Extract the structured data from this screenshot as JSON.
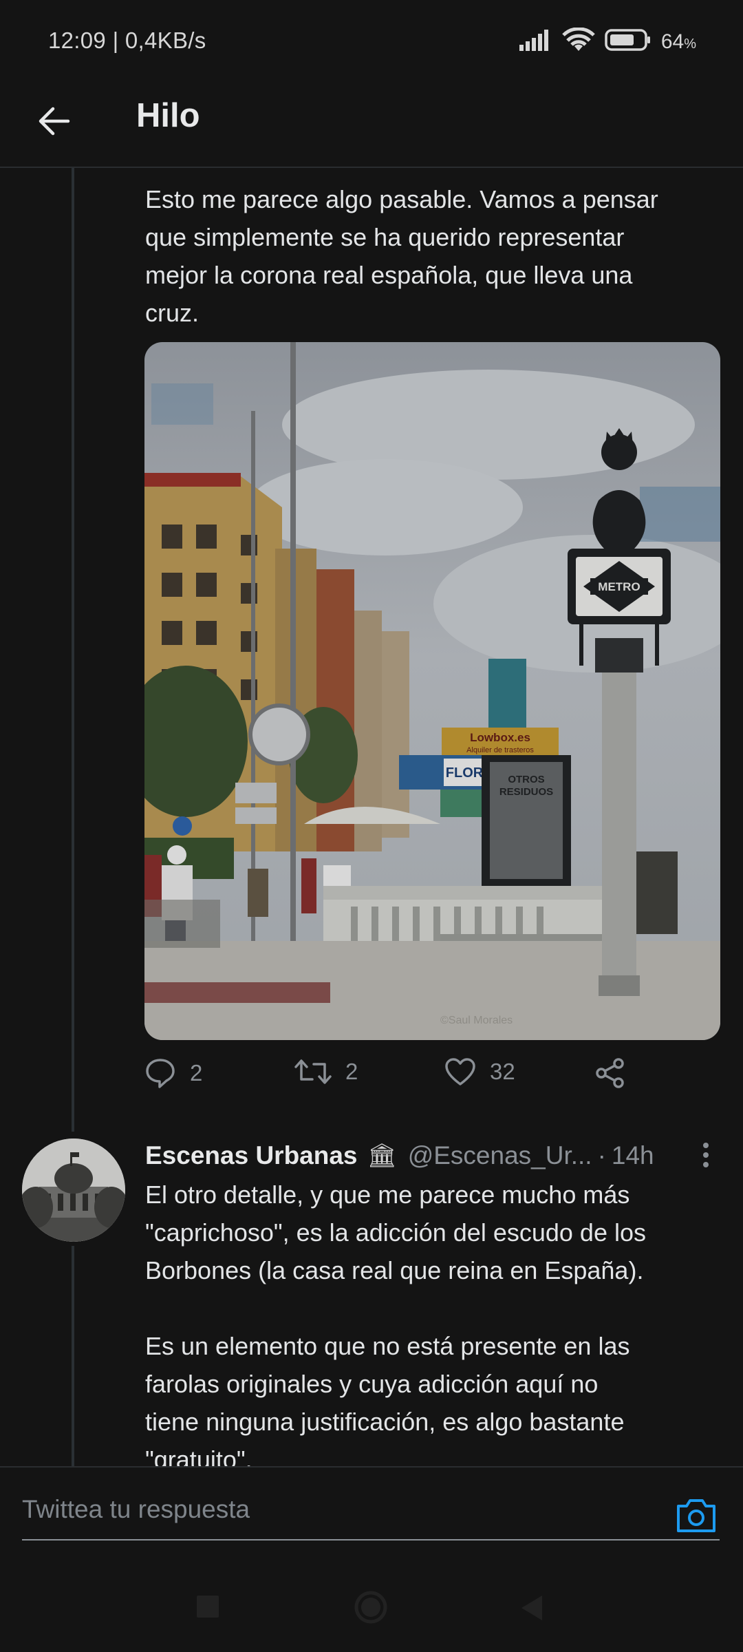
{
  "status": {
    "time": "12:09",
    "speed": "0,4KB/s",
    "battery_pct": "64",
    "battery_unit": "%",
    "icons": [
      "signal-icon",
      "wifi-icon",
      "battery-icon"
    ]
  },
  "header": {
    "title": "Hilo",
    "back_icon": "arrow-left-icon"
  },
  "tweet1": {
    "text": "Esto me parece algo pasable. Vamos a pensar\nque simplemente se ha querido representar\nmejor la corona real española, que lleva una\ncruz.",
    "image": {
      "sign_text": "METRO",
      "shop_sign_1": "Lowbox.es",
      "shop_sign_2": "Alquiler de trasteros",
      "shop_sign_3": "FLOR",
      "kiosk_text": "OTROS\nRESIDUOS",
      "watermark": "©Saul Morales"
    },
    "actions": {
      "replies": "2",
      "retweets": "2",
      "likes": "32"
    }
  },
  "tweet2": {
    "name": "Escenas Urbanas",
    "name_badge": "🏛",
    "handle": "@Escenas_Ur...",
    "time": "14h",
    "text": "El otro detalle, y que me parece mucho más\n\"caprichoso\", es la adicción del escudo de los\nBorbones (la casa real que reina en España).",
    "text2": "Es un elemento que no está presente en las\nfarolas originales y cuya adicción aquí no\ntiene ninguna justificación, es algo bastante\n\"gratuito\"."
  },
  "reply": {
    "placeholder": "Twittea tu respuesta"
  },
  "colors": {
    "background": "#141414",
    "accent": "#1d9bf0",
    "muted": "#8b9096"
  }
}
